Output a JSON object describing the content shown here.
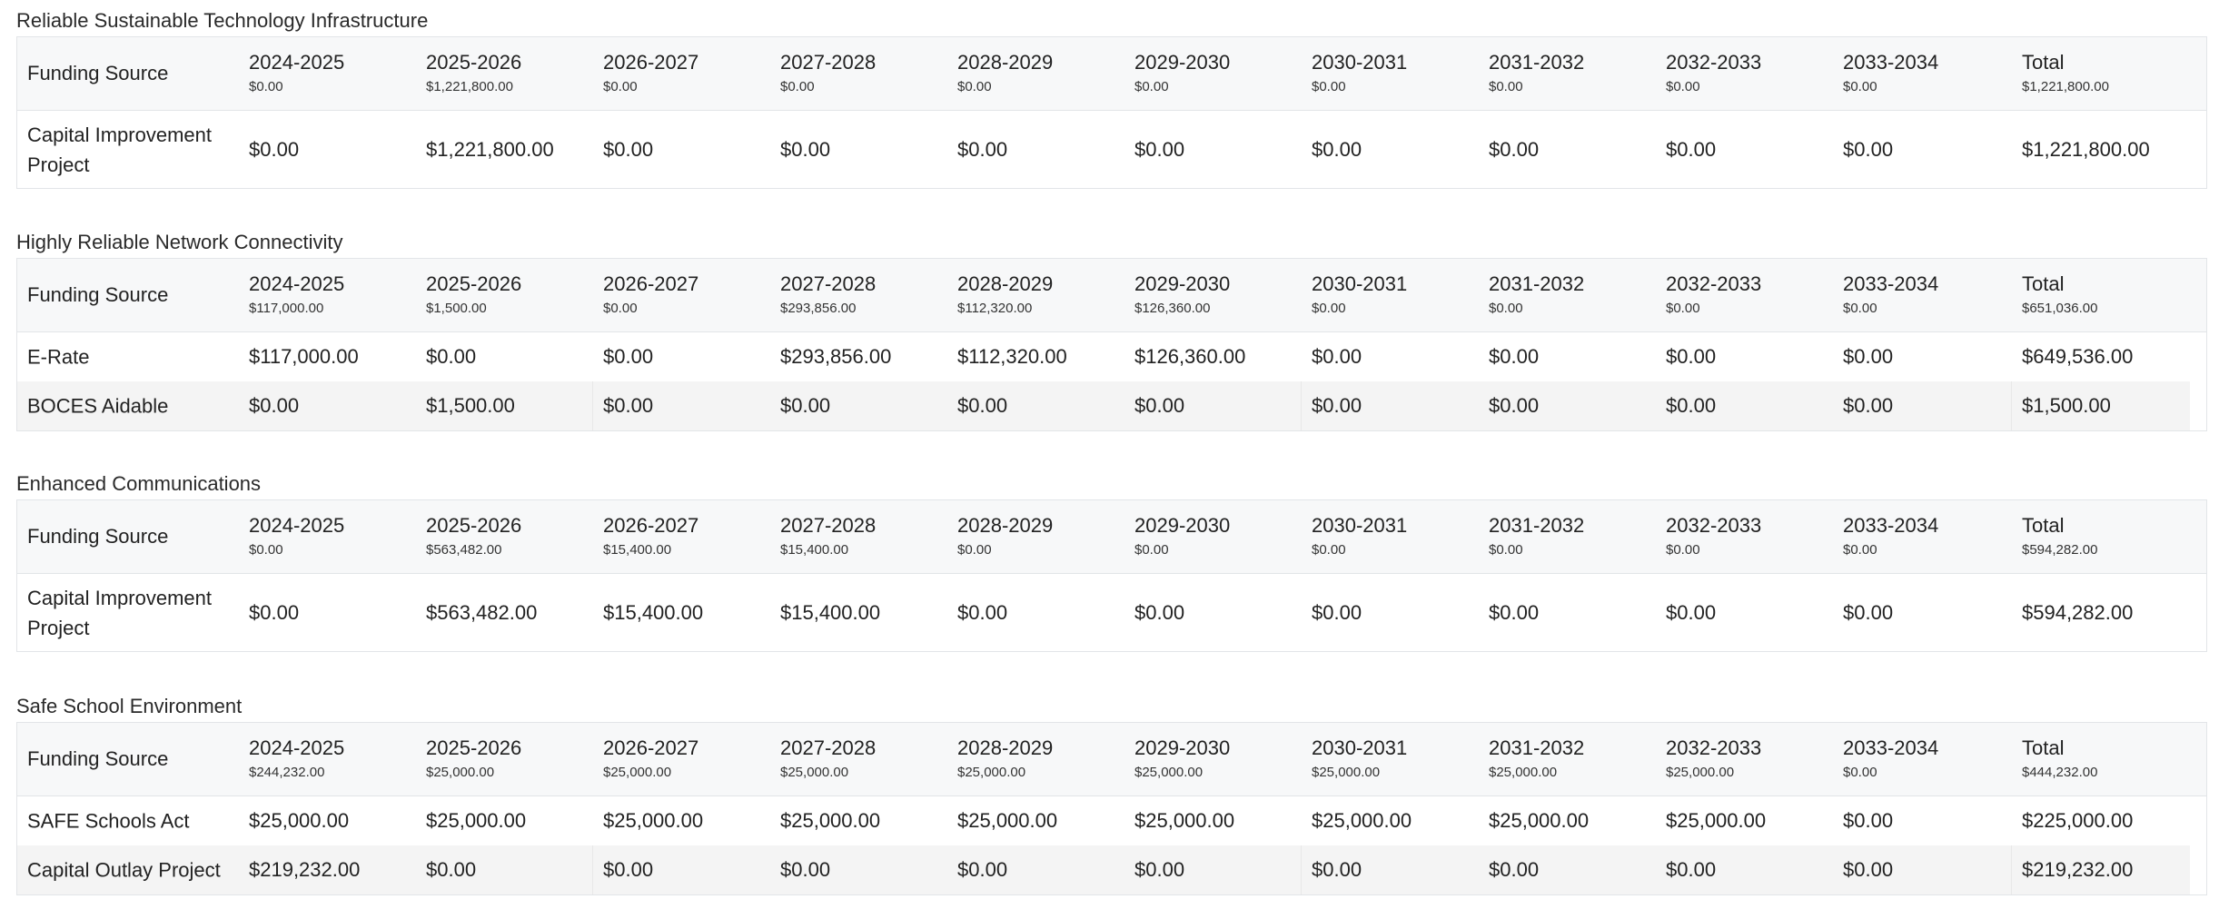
{
  "sections": [
    {
      "title": "Reliable Sustainable Technology Infrastructure",
      "header_label": "Funding Source",
      "years": [
        "2024-2025",
        "2025-2026",
        "2026-2027",
        "2027-2028",
        "2028-2029",
        "2029-2030",
        "2030-2031",
        "2031-2032",
        "2032-2033",
        "2033-2034",
        "Total"
      ],
      "subtotals": [
        "$0.00",
        "$1,221,800.00",
        "$0.00",
        "$0.00",
        "$0.00",
        "$0.00",
        "$0.00",
        "$0.00",
        "$0.00",
        "$0.00",
        "$1,221,800.00"
      ],
      "rows": [
        {
          "source": "Capital Improvement Project",
          "values": [
            "$0.00",
            "$1,221,800.00",
            "$0.00",
            "$0.00",
            "$0.00",
            "$0.00",
            "$0.00",
            "$0.00",
            "$0.00",
            "$0.00",
            "$1,221,800.00"
          ]
        }
      ]
    },
    {
      "title": "Highly Reliable Network Connectivity",
      "header_label": "Funding Source",
      "years": [
        "2024-2025",
        "2025-2026",
        "2026-2027",
        "2027-2028",
        "2028-2029",
        "2029-2030",
        "2030-2031",
        "2031-2032",
        "2032-2033",
        "2033-2034",
        "Total"
      ],
      "subtotals": [
        "$117,000.00",
        "$1,500.00",
        "$0.00",
        "$293,856.00",
        "$112,320.00",
        "$126,360.00",
        "$0.00",
        "$0.00",
        "$0.00",
        "$0.00",
        "$651,036.00"
      ],
      "rows": [
        {
          "source": "E-Rate",
          "values": [
            "$117,000.00",
            "$0.00",
            "$0.00",
            "$293,856.00",
            "$112,320.00",
            "$126,360.00",
            "$0.00",
            "$0.00",
            "$0.00",
            "$0.00",
            "$649,536.00"
          ]
        },
        {
          "source": "BOCES Aidable",
          "values": [
            "$0.00",
            "$1,500.00",
            "$0.00",
            "$0.00",
            "$0.00",
            "$0.00",
            "$0.00",
            "$0.00",
            "$0.00",
            "$0.00",
            "$1,500.00"
          ]
        }
      ]
    },
    {
      "title": "Enhanced Communications",
      "header_label": "Funding Source",
      "years": [
        "2024-2025",
        "2025-2026",
        "2026-2027",
        "2027-2028",
        "2028-2029",
        "2029-2030",
        "2030-2031",
        "2031-2032",
        "2032-2033",
        "2033-2034",
        "Total"
      ],
      "subtotals": [
        "$0.00",
        "$563,482.00",
        "$15,400.00",
        "$15,400.00",
        "$0.00",
        "$0.00",
        "$0.00",
        "$0.00",
        "$0.00",
        "$0.00",
        "$594,282.00"
      ],
      "rows": [
        {
          "source": "Capital Improvement Project",
          "values": [
            "$0.00",
            "$563,482.00",
            "$15,400.00",
            "$15,400.00",
            "$0.00",
            "$0.00",
            "$0.00",
            "$0.00",
            "$0.00",
            "$0.00",
            "$594,282.00"
          ]
        }
      ]
    },
    {
      "title": "Safe School Environment",
      "header_label": "Funding Source",
      "years": [
        "2024-2025",
        "2025-2026",
        "2026-2027",
        "2027-2028",
        "2028-2029",
        "2029-2030",
        "2030-2031",
        "2031-2032",
        "2032-2033",
        "2033-2034",
        "Total"
      ],
      "subtotals": [
        "$244,232.00",
        "$25,000.00",
        "$25,000.00",
        "$25,000.00",
        "$25,000.00",
        "$25,000.00",
        "$25,000.00",
        "$25,000.00",
        "$25,000.00",
        "$0.00",
        "$444,232.00"
      ],
      "rows": [
        {
          "source": "SAFE Schools Act",
          "values": [
            "$25,000.00",
            "$25,000.00",
            "$25,000.00",
            "$25,000.00",
            "$25,000.00",
            "$25,000.00",
            "$25,000.00",
            "$25,000.00",
            "$25,000.00",
            "$0.00",
            "$225,000.00"
          ]
        },
        {
          "source": "Capital Outlay Project",
          "values": [
            "$219,232.00",
            "$0.00",
            "$0.00",
            "$0.00",
            "$0.00",
            "$0.00",
            "$0.00",
            "$0.00",
            "$0.00",
            "$0.00",
            "$219,232.00"
          ]
        }
      ]
    }
  ]
}
